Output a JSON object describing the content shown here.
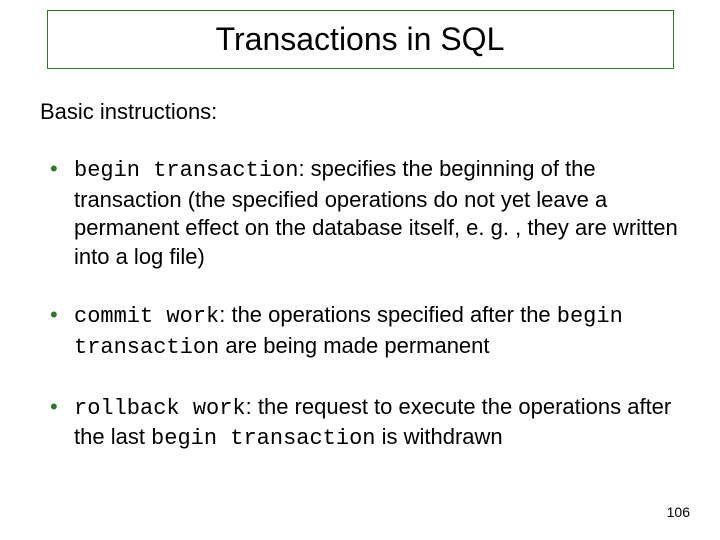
{
  "title": "Transactions in SQL",
  "subheading": "Basic instructions:",
  "bullets": [
    {
      "code1": "begin transaction",
      "text1": ": specifies the beginning of the transaction (the specified operations do not yet leave a permanent effect on the database itself, e. g. , they are written into a log file)"
    },
    {
      "code1": "commit work",
      "text1": ": the operations specified after the ",
      "code2": "begin transaction",
      "text2": " are being made permanent"
    },
    {
      "code1": "rollback work",
      "text1": ": the request to execute the operations after the last ",
      "code2": "begin transaction",
      "text2": " is withdrawn"
    }
  ],
  "pageNumber": "106"
}
